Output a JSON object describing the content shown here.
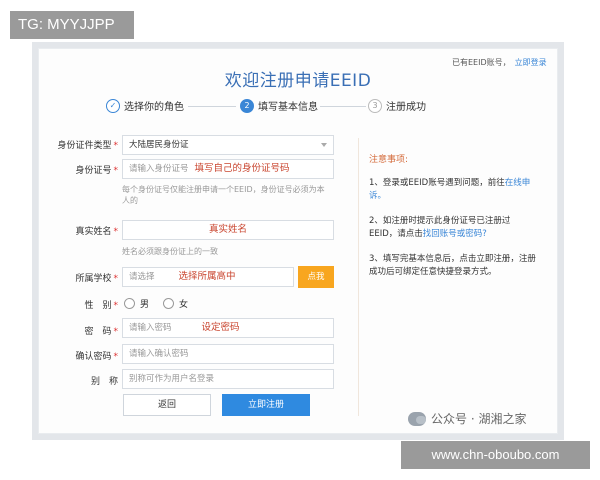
{
  "tg_tag": "TG: MYYJJPP",
  "top": {
    "has_account": "已有EEID账号，",
    "login_link": "立即登录"
  },
  "title": "欢迎注册申请EEID",
  "steps": [
    {
      "num": "✓",
      "label": "选择你的角色",
      "state": "done"
    },
    {
      "num": "2",
      "label": "填写基本信息",
      "state": "active"
    },
    {
      "num": "3",
      "label": "注册成功",
      "state": "todo"
    }
  ],
  "form": {
    "id_type": {
      "label": "身份证件类型",
      "value": "大陆居民身份证"
    },
    "id_number": {
      "label": "身份证号",
      "placeholder": "请输入身份证号",
      "tip": "填写自己的身份证号码",
      "help": "每个身份证号仅能注册申请一个EEID，身份证号必须为本人的"
    },
    "name": {
      "label": "真实姓名",
      "tip": "真实姓名",
      "help": "姓名必须跟身份证上的一致"
    },
    "school": {
      "label": "所属学校",
      "placeholder": "请选择",
      "tip": "选择所属高中",
      "button": "点我"
    },
    "gender": {
      "label": "性　别",
      "male": "男",
      "female": "女"
    },
    "password": {
      "label": "密　码",
      "placeholder": "请输入密码",
      "tip": "设定密码"
    },
    "confirm": {
      "label": "确认密码",
      "placeholder": "请输入确认密码"
    },
    "nickname": {
      "label": "别　称",
      "placeholder": "别称可作为用户名登录"
    }
  },
  "buttons": {
    "back": "返回",
    "submit": "立即注册"
  },
  "notes": {
    "title": "注意事项:",
    "note1": {
      "text": "1、登录或EEID账号遇到问题，前往",
      "link": "在线申诉。"
    },
    "note2": {
      "text": "2、如注册时提示此身份证号已注册过EEID，请点击",
      "link": "找回账号或密码?"
    },
    "note3": {
      "text": "3、填写完基本信息后，点击立即注册，注册成功后可绑定任意快捷登录方式。"
    }
  },
  "watermark": "公众号 · 湖湘之家",
  "site_tag": "www.chn-oboubo.com"
}
